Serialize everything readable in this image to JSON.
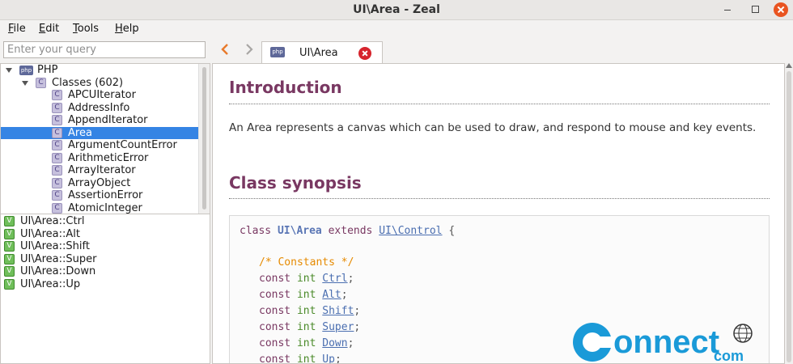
{
  "window": {
    "title": "UI\\Area - Zeal"
  },
  "menu": [
    {
      "label": "File",
      "mnemonic": "F",
      "rest": "ile"
    },
    {
      "label": "Edit",
      "mnemonic": "E",
      "rest": "dit"
    },
    {
      "label": "Tools",
      "mnemonic": "T",
      "rest": "ools"
    },
    {
      "label": "Help",
      "mnemonic": "H",
      "rest": "elp"
    }
  ],
  "search": {
    "placeholder": "Enter your query",
    "value": ""
  },
  "tab": {
    "icon_text": "php",
    "label": "UI\\Area"
  },
  "tree": {
    "root": {
      "icon_text": "php",
      "label": "PHP"
    },
    "group": {
      "icon_text": "C",
      "label": "Classes (602)"
    },
    "items": [
      "APCUIterator",
      "AddressInfo",
      "AppendIterator",
      "Area",
      "ArgumentCountError",
      "ArithmeticError",
      "ArrayIterator",
      "ArrayObject",
      "AssertionError",
      "AtomicInteger"
    ],
    "selected": "Area"
  },
  "symbols": {
    "icon_text": "V",
    "items": [
      "UI\\Area::Ctrl",
      "UI\\Area::Alt",
      "UI\\Area::Shift",
      "UI\\Area::Super",
      "UI\\Area::Down",
      "UI\\Area::Up"
    ]
  },
  "doc": {
    "intro_heading": "Introduction",
    "intro_text": "An Area represents a canvas which can be used to draw, and respond to mouse and key events.",
    "synopsis_heading": "Class synopsis",
    "synopsis": {
      "kw_class": "class",
      "class_name": "UI\\Area",
      "kw_extends": "extends",
      "parent": "UI\\Control",
      "open_brace": "{",
      "comment": "/* Constants */",
      "kw_const": "const",
      "kw_int": "int",
      "constants": [
        "Ctrl",
        "Alt",
        "Shift",
        "Super",
        "Down",
        "Up"
      ]
    }
  },
  "watermark": {
    "text_main": "onnect",
    "text_sub": "com"
  },
  "colors": {
    "heading": "#793862",
    "selection": "#3584e4",
    "close_tab": "#d6242d",
    "nav_back": "#e87a2b"
  }
}
